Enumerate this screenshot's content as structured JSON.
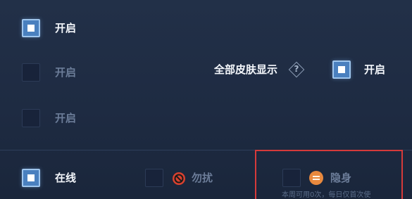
{
  "toggles": [
    {
      "label": "开启",
      "checked": true
    },
    {
      "label": "开启",
      "checked": false
    },
    {
      "label": "开启",
      "checked": false
    }
  ],
  "skin_display": {
    "label": "全部皮肤显示",
    "help_glyph": "?",
    "help_icon": "question-diamond-icon",
    "checked": true,
    "toggle_label": "开启"
  },
  "status_options": [
    {
      "label": "在线",
      "checked": true,
      "icon": null
    },
    {
      "label": "勿扰",
      "checked": false,
      "icon": "do-not-disturb-icon"
    },
    {
      "label": "隐身",
      "checked": false,
      "icon": "invisible-icon"
    }
  ],
  "invisible_note": "本周可用0次，每日仅首次使",
  "colors": {
    "accent_checked": "#4a80bf",
    "highlight_border": "#d63a3a",
    "dnd_icon": "#d8412f",
    "invisible_icon": "#e8893e"
  }
}
